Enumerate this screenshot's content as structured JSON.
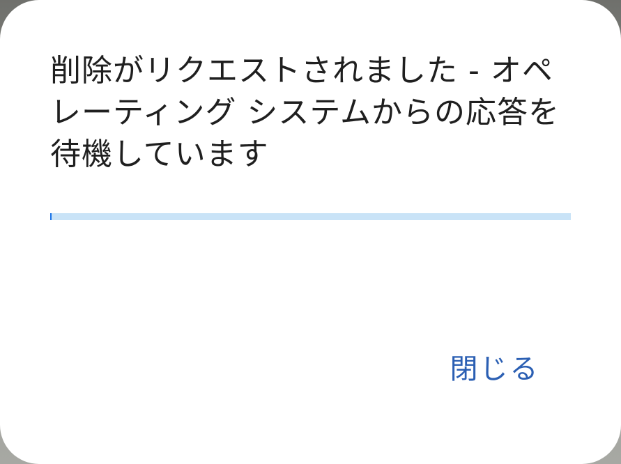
{
  "dialog": {
    "title": "削除がリクエストされました - オペレーティング システムからの応答を待機しています",
    "progress": {
      "fraction": 0.002,
      "color": "#1a73e8",
      "track_color": "#c9e3f7"
    },
    "close_label": "閉じる",
    "accent_color": "#2b5fb3"
  }
}
